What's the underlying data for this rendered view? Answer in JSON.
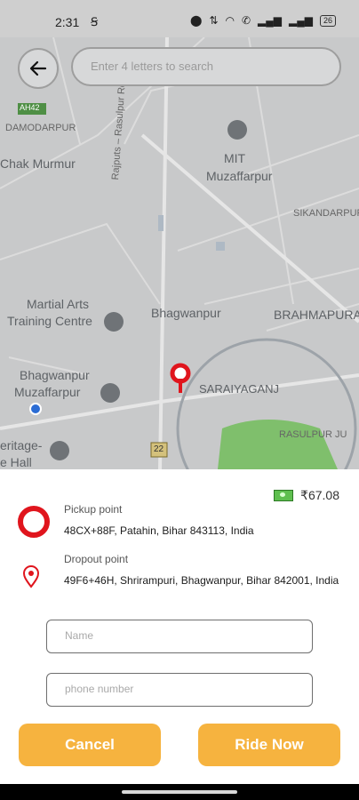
{
  "status_bar": {
    "time": "2:31",
    "battery": "26"
  },
  "search": {
    "placeholder": "Enter 4 letters to search"
  },
  "map": {
    "labels": {
      "ah42": "AH42",
      "damodarpur": "DAMODARPUR",
      "chak_murmur": "Chak Murmur",
      "rajputs_rd": "Rajputs – Rasulpur Rd",
      "mit_line1": "MIT",
      "mit_line2": "Muzaffarpur",
      "sikandarpur": "SIKANDARPUR",
      "martial_line1": "Martial Arts",
      "martial_line2": "Training Centre",
      "bhagwanpur": "Bhagwanpur",
      "brahmapura": "BRAHMAPURA",
      "bhagwanpur_muz_line1": "Bhagwanpur",
      "bhagwanpur_muz_line2": "Muzaffarpur",
      "saraiyaganj": "SARAIYAGANJ",
      "rasulpur": "RASULPUR JU",
      "heritage_line1": "eritage-",
      "heritage_line2": "e Hall",
      "road_22": "22"
    }
  },
  "trip": {
    "price": "₹67.08",
    "pickup_label": "Pickup point",
    "pickup_address": "48CX+88F, Patahin, Bihar 843113, India",
    "dropout_label": "Dropout point",
    "dropout_address": "49F6+46H, Shrirampuri, Bhagwanpur, Bihar 842001, India"
  },
  "form": {
    "name_placeholder": "Name",
    "phone_placeholder": "phone number"
  },
  "actions": {
    "cancel": "Cancel",
    "ride_now": "Ride Now"
  },
  "colors": {
    "accent": "#f6b33f",
    "pin_red": "#e0151d"
  }
}
